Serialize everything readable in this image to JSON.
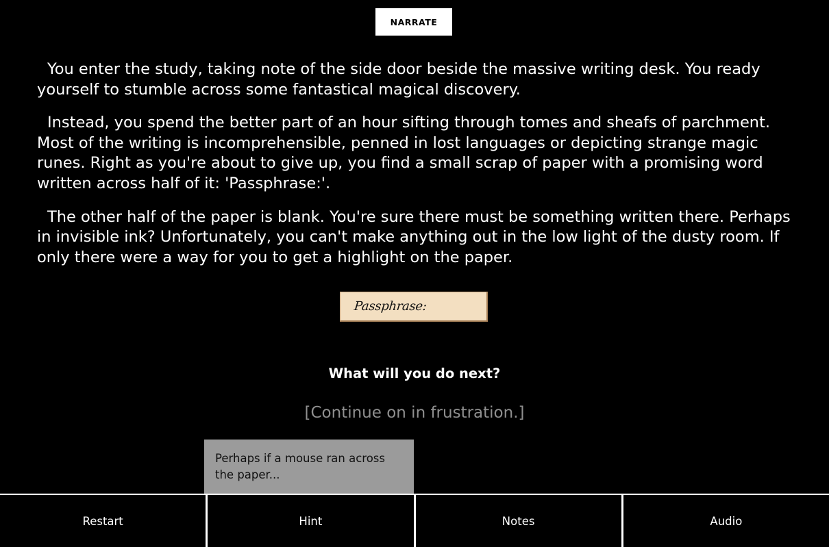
{
  "narrate_label": "NARRATE",
  "story": {
    "paragraphs": [
      "You enter the study, taking note of the side door beside the massive writing desk. You ready yourself to stumble across some fantastical magical discovery.",
      "Instead, you spend the better part of an hour sifting through tomes and sheafs of parchment. Most of the writing is incomprehensible, penned in lost languages or depicting strange magic runes. Right as you're about to give up, you find a small scrap of paper with a promising word written across half of it: 'Passphrase:'.",
      "The other half of the paper is blank. You're sure there must be something written there. Perhaps in invisible ink? Unfortunately, you can't make anything out in the low light of the dusty room. If only there were a way for you to get a highlight on the paper."
    ]
  },
  "scrap": {
    "text": "Passphrase:"
  },
  "prompt": "What will you do next?",
  "choices": [
    "[Continue on in frustration.]"
  ],
  "hint_popup": "Perhaps if a mouse ran across the paper...",
  "menu": {
    "items": [
      "Restart",
      "Hint",
      "Notes",
      "Audio"
    ]
  },
  "colors": {
    "background": "#000000",
    "text": "#ffffff",
    "choice": "#8f8f8f",
    "scrap": "#f3dfc1",
    "hint_popup": "#9b9b9b"
  }
}
